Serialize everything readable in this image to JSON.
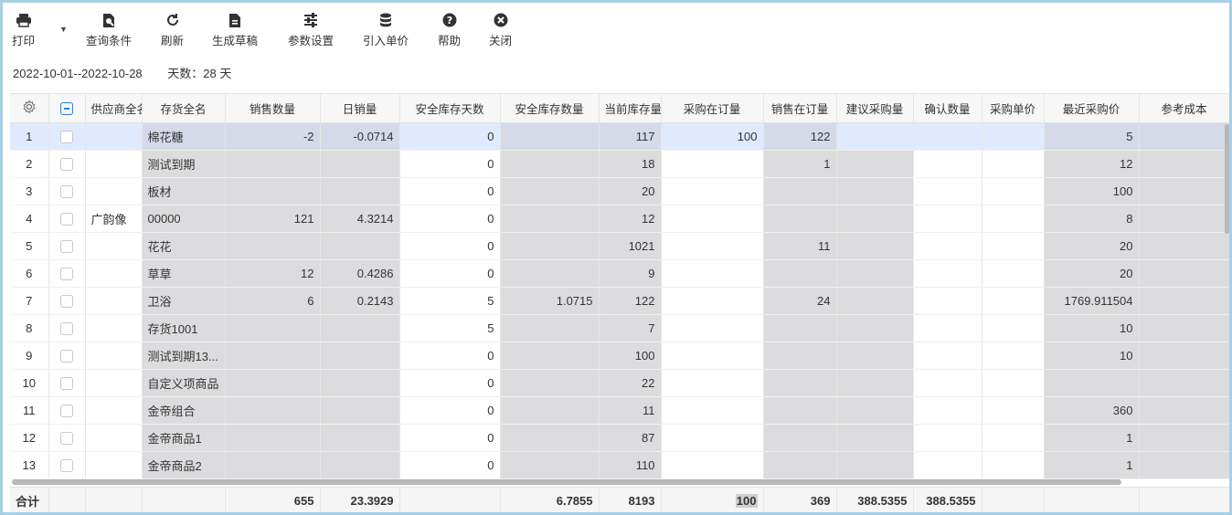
{
  "toolbar": {
    "print": "打印",
    "query": "查询条件",
    "refresh": "刷新",
    "draft": "生成草稿",
    "params": "参数设置",
    "import_price": "引入单价",
    "help": "帮助",
    "close": "关闭",
    "icons": [
      "printer-icon",
      "query-doc-icon",
      "refresh-icon",
      "document-icon",
      "sliders-icon",
      "database-icon",
      "help-icon",
      "close-icon"
    ]
  },
  "period": {
    "range": "2022-10-01--2022-10-28",
    "days": "天数：28 天"
  },
  "columns": [
    "供应商全名",
    "存货全名",
    "销售数量",
    "日销量",
    "安全库存天数",
    "安全库存数量",
    "当前库存量",
    "采购在订量",
    "销售在订量",
    "建议采购量",
    "确认数量",
    "采购单价",
    "最近采购价",
    "参考成本"
  ],
  "rows": [
    {
      "no": "1",
      "supplier": "",
      "name": "棉花糖",
      "sales": "-2",
      "daily": "-0.0714",
      "safe_days": "0",
      "safe_qty": "",
      "stock": "117",
      "po": "100",
      "so": "122",
      "suggest": "",
      "confirm": "",
      "price": "",
      "last": "5",
      "ref": ""
    },
    {
      "no": "2",
      "supplier": "",
      "name": "测试到期",
      "sales": "",
      "daily": "",
      "safe_days": "0",
      "safe_qty": "",
      "stock": "18",
      "po": "",
      "so": "1",
      "suggest": "",
      "confirm": "",
      "price": "",
      "last": "12",
      "ref": ""
    },
    {
      "no": "3",
      "supplier": "",
      "name": "板材",
      "sales": "",
      "daily": "",
      "safe_days": "0",
      "safe_qty": "",
      "stock": "20",
      "po": "",
      "so": "",
      "suggest": "",
      "confirm": "",
      "price": "",
      "last": "100",
      "ref": ""
    },
    {
      "no": "4",
      "supplier": "广韵像",
      "name": "00000",
      "sales": "121",
      "daily": "4.3214",
      "safe_days": "0",
      "safe_qty": "",
      "stock": "12",
      "po": "",
      "so": "",
      "suggest": "",
      "confirm": "",
      "price": "",
      "last": "8",
      "ref": ""
    },
    {
      "no": "5",
      "supplier": "",
      "name": "花花",
      "sales": "",
      "daily": "",
      "safe_days": "0",
      "safe_qty": "",
      "stock": "1021",
      "po": "",
      "so": "11",
      "suggest": "",
      "confirm": "",
      "price": "",
      "last": "20",
      "ref": ""
    },
    {
      "no": "6",
      "supplier": "",
      "name": "草草",
      "sales": "12",
      "daily": "0.4286",
      "safe_days": "0",
      "safe_qty": "",
      "stock": "9",
      "po": "",
      "so": "",
      "suggest": "",
      "confirm": "",
      "price": "",
      "last": "20",
      "ref": ""
    },
    {
      "no": "7",
      "supplier": "",
      "name": "卫浴",
      "sales": "6",
      "daily": "0.2143",
      "safe_days": "5",
      "safe_qty": "1.0715",
      "stock": "122",
      "po": "",
      "so": "24",
      "suggest": "",
      "confirm": "",
      "price": "",
      "last": "1769.911504",
      "ref": ""
    },
    {
      "no": "8",
      "supplier": "",
      "name": "存货1001",
      "sales": "",
      "daily": "",
      "safe_days": "5",
      "safe_qty": "",
      "stock": "7",
      "po": "",
      "so": "",
      "suggest": "",
      "confirm": "",
      "price": "",
      "last": "10",
      "ref": ""
    },
    {
      "no": "9",
      "supplier": "",
      "name": "测试到期13...",
      "sales": "",
      "daily": "",
      "safe_days": "0",
      "safe_qty": "",
      "stock": "100",
      "po": "",
      "so": "",
      "suggest": "",
      "confirm": "",
      "price": "",
      "last": "10",
      "ref": ""
    },
    {
      "no": "10",
      "supplier": "",
      "name": "自定义项商品",
      "sales": "",
      "daily": "",
      "safe_days": "0",
      "safe_qty": "",
      "stock": "22",
      "po": "",
      "so": "",
      "suggest": "",
      "confirm": "",
      "price": "",
      "last": "",
      "ref": ""
    },
    {
      "no": "11",
      "supplier": "",
      "name": "金帝组合",
      "sales": "",
      "daily": "",
      "safe_days": "0",
      "safe_qty": "",
      "stock": "11",
      "po": "",
      "so": "",
      "suggest": "",
      "confirm": "",
      "price": "",
      "last": "360",
      "ref": ""
    },
    {
      "no": "12",
      "supplier": "",
      "name": "金帝商品1",
      "sales": "",
      "daily": "",
      "safe_days": "0",
      "safe_qty": "",
      "stock": "87",
      "po": "",
      "so": "",
      "suggest": "",
      "confirm": "",
      "price": "",
      "last": "1",
      "ref": ""
    },
    {
      "no": "13",
      "supplier": "",
      "name": "金帝商品2",
      "sales": "",
      "daily": "",
      "safe_days": "0",
      "safe_qty": "",
      "stock": "110",
      "po": "",
      "so": "",
      "suggest": "",
      "confirm": "",
      "price": "",
      "last": "1",
      "ref": ""
    }
  ],
  "footer": {
    "label": "合计",
    "sales": "655",
    "daily": "23.3929",
    "safe_days": "",
    "safe_qty": "6.7855",
    "stock": "8193",
    "po": "100",
    "so": "369",
    "suggest": "388.5355",
    "confirm": "388.5355",
    "price": "",
    "last": "",
    "ref": ""
  },
  "colors": {
    "frame": "#a9cfe6",
    "selected_row": "#dfeaff",
    "readonly_cell": "#dcdcdf",
    "accent": "#2f7de1"
  }
}
